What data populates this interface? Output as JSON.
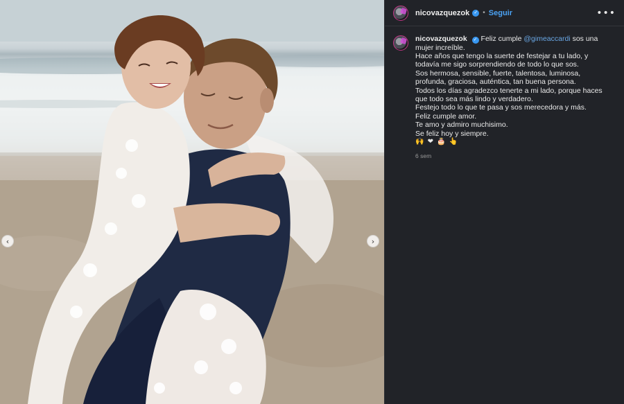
{
  "post": {
    "username": "nicovazquezok",
    "follow_label": "Seguir",
    "separator": "•",
    "more_label": "•••",
    "verified_glyph": "✓"
  },
  "caption": {
    "username": "nicovazquezok",
    "first_text": "Feliz cumple",
    "mention": "@gimeaccardi",
    "first_rest": "sos una mujer increíble.",
    "lines": [
      "Hace años que tengo la suerte de festejar a tu lado, y todavía me sigo sorprendiendo de todo lo que sos.",
      "Sos hermosa, sensible, fuerte, talentosa, luminosa, profunda, graciosa, auténtica, tan buena persona.",
      "Todos los días agradezco tenerte a mi lado, porque haces que todo sea más lindo y verdadero.",
      "Festejo todo lo que te pasa y sos merecedora y más.",
      "Feliz cumple amor.",
      "Te amo y admiro muchisimo.",
      "Se feliz hoy y siempre."
    ],
    "emojis": "🙌 ❤ 🎂 👆",
    "time": "6 sem"
  },
  "carousel": {
    "prev_glyph": "‹",
    "next_glyph": "›"
  },
  "colors": {
    "panel": "#212328",
    "link": "#4ba3f5",
    "mention": "#6aa8e6",
    "verified": "#3897f0"
  }
}
